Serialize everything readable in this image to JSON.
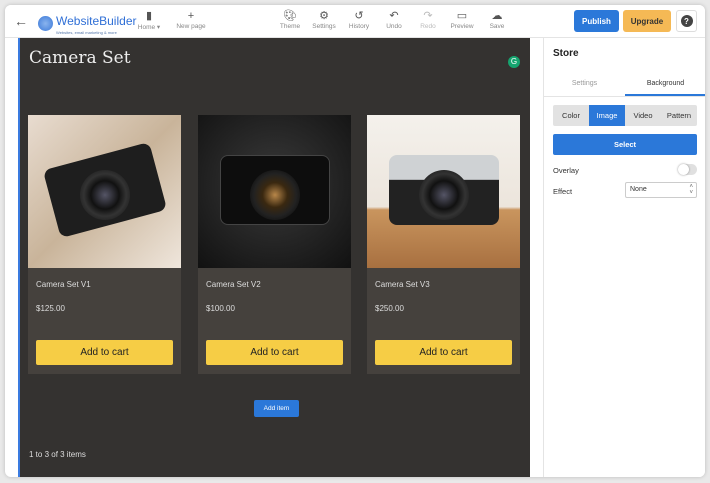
{
  "header": {
    "logo": "WebsiteBuilder",
    "logo_tagline": "Websites, email marketing & more",
    "tools": [
      {
        "label": "Home ▾",
        "icon": "page-icon"
      },
      {
        "label": "New page",
        "icon": "plus-icon"
      },
      {
        "label": "Theme",
        "icon": "palette-icon"
      },
      {
        "label": "Settings",
        "icon": "gear-icon"
      },
      {
        "label": "History",
        "icon": "history-icon"
      },
      {
        "label": "Undo",
        "icon": "undo-icon"
      },
      {
        "label": "Redo",
        "icon": "redo-icon"
      },
      {
        "label": "Preview",
        "icon": "monitor-icon"
      },
      {
        "label": "Save",
        "icon": "cloud-icon"
      }
    ],
    "publish": "Publish",
    "upgrade": "Upgrade",
    "help": "?"
  },
  "canvas": {
    "title": "Camera Set",
    "grammarly": "G",
    "products": [
      {
        "name": "Camera Set V1",
        "price": "$125.00",
        "button": "Add to cart"
      },
      {
        "name": "Camera Set V2",
        "price": "$100.00",
        "button": "Add to cart"
      },
      {
        "name": "Camera Set V3",
        "price": "$250.00",
        "button": "Add to cart"
      }
    ],
    "add_item": "Add item",
    "count": "1 to 3 of 3 items"
  },
  "panel": {
    "title": "Store",
    "tabs": [
      "Settings",
      "Background"
    ],
    "active_tab": "Background",
    "segments": [
      "Color",
      "Image",
      "Video",
      "Pattern"
    ],
    "active_segment": "Image",
    "select": "Select",
    "overlay_label": "Overlay",
    "overlay_on": false,
    "effect_label": "Effect",
    "effect_value": "None"
  },
  "colors": {
    "accent": "#2b78d9",
    "upgrade": "#f5b955",
    "cart": "#f6cd45",
    "canvas": "#343230"
  }
}
